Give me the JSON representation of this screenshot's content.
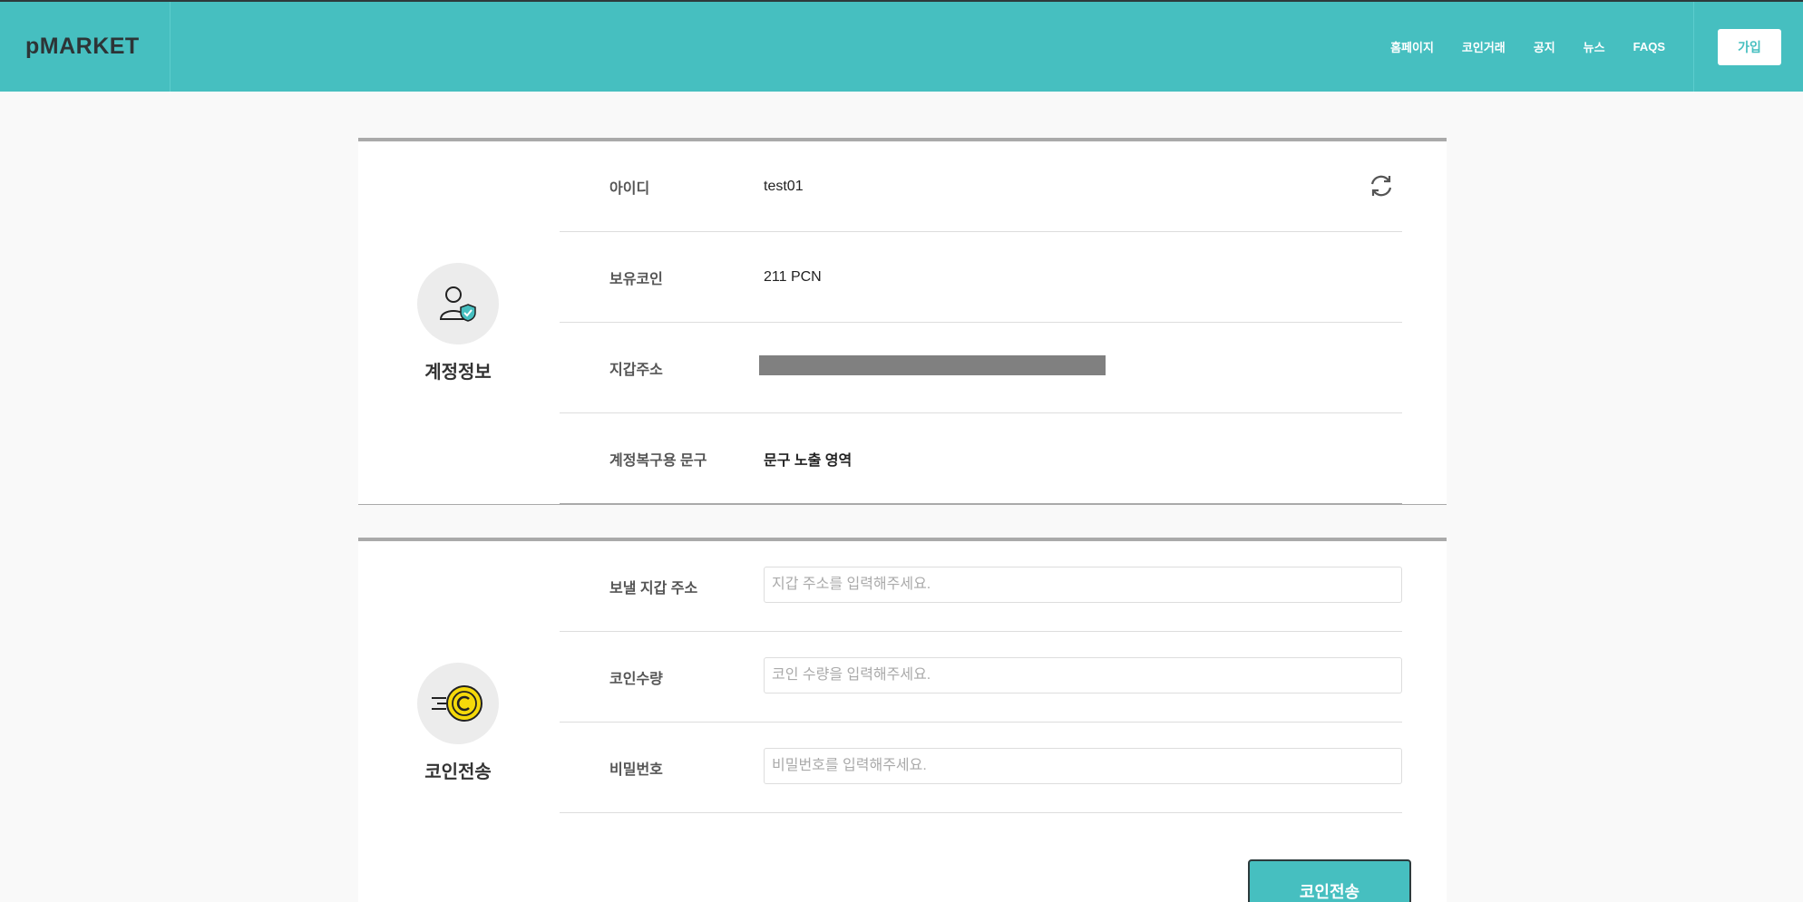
{
  "header": {
    "logo": "pMARKET",
    "nav": [
      "홈페이지",
      "코인거래",
      "공지",
      "뉴스",
      "FAQS"
    ],
    "join_label": "가입"
  },
  "account": {
    "section_title": "계정정보",
    "rows": [
      {
        "label": "아이디",
        "value": "test01"
      },
      {
        "label": "보유코인",
        "value": "211 PCN"
      },
      {
        "label": "지갑주소",
        "value": ""
      },
      {
        "label": "계정복구용 문구",
        "value": "문구 노출 영역"
      }
    ]
  },
  "transfer": {
    "section_title": "코인전송",
    "fields": [
      {
        "label": "보낼 지갑 주소",
        "placeholder": "지갑 주소를 입력해주세요."
      },
      {
        "label": "코인수량",
        "placeholder": "코인 수량을 입력해주세요."
      },
      {
        "label": "비밀번호",
        "placeholder": "비밀번호를 입력해주세요."
      }
    ],
    "submit_label": "코인전송"
  },
  "colors": {
    "accent": "#46bfc0",
    "coin": "#f5d90a"
  },
  "icons": [
    "user-shield-icon",
    "refresh-icon",
    "coin-transfer-icon"
  ]
}
